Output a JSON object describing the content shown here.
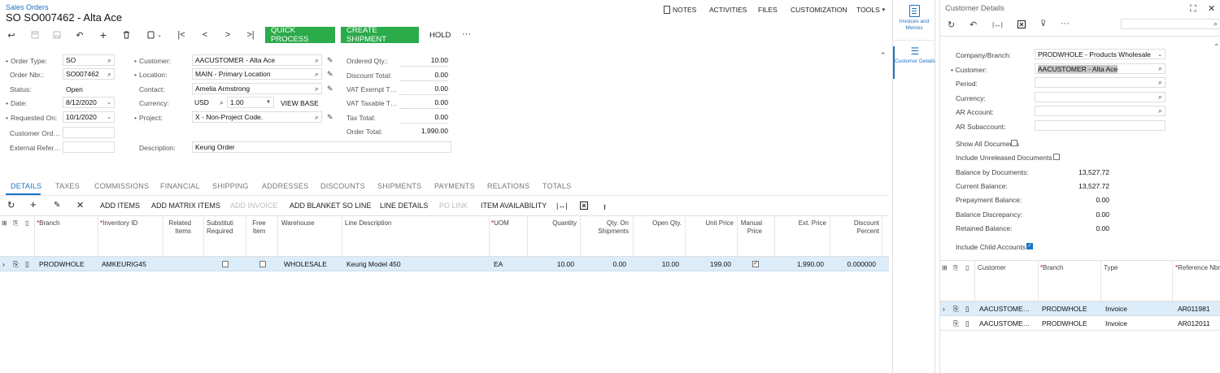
{
  "breadcrumb": "Sales Orders",
  "page_title": "SO SO007462 - Alta Ace",
  "top_menu": {
    "notes": "NOTES",
    "activities": "ACTIVITIES",
    "files": "FILES",
    "customization": "CUSTOMIZATION",
    "tools": "TOOLS"
  },
  "toolbar": {
    "quick_process": "QUICK PROCESS",
    "create_shipment": "CREATE SHIPMENT",
    "hold": "HOLD",
    "more": "···"
  },
  "form": {
    "order_type_label": "Order Type:",
    "order_type": "SO",
    "order_nbr_label": "Order Nbr.:",
    "order_nbr": "SO007462",
    "status_label": "Status:",
    "status": "Open",
    "date_label": "Date:",
    "date": "8/12/2020",
    "requested_on_label": "Requested On:",
    "requested_on": "10/1/2020",
    "customer_ord_label": "Customer Ord…",
    "customer_ord": "",
    "external_ref_label": "External Refer…",
    "external_ref": "",
    "customer_label": "Customer:",
    "customer": "AACUSTOMER - Alta Ace",
    "location_label": "Location:",
    "location": "MAIN - Primary Location",
    "contact_label": "Contact:",
    "contact": "Amelia Armstrong",
    "currency_label": "Currency:",
    "currency": "USD",
    "currency_rate": "1.00",
    "view_base": "VIEW BASE",
    "project_label": "Project:",
    "project": "X - Non-Project Code.",
    "description_label": "Description:",
    "description": "Keurig Order",
    "ordered_qty_label": "Ordered Qty.:",
    "ordered_qty": "10.00",
    "discount_total_label": "Discount Total:",
    "discount_total": "0.00",
    "vat_exempt_label": "VAT Exempt T…",
    "vat_exempt": "0.00",
    "vat_taxable_label": "VAT Taxable T…",
    "vat_taxable": "0.00",
    "tax_total_label": "Tax Total:",
    "tax_total": "0.00",
    "order_total_label": "Order Total:",
    "order_total": "1,990.00"
  },
  "tabs": [
    "DETAILS",
    "TAXES",
    "COMMISSIONS",
    "FINANCIAL",
    "SHIPPING",
    "ADDRESSES",
    "DISCOUNTS",
    "SHIPMENTS",
    "PAYMENTS",
    "RELATIONS",
    "TOTALS"
  ],
  "grid_toolbar": {
    "add_items": "ADD ITEMS",
    "add_matrix_items": "ADD MATRIX ITEMS",
    "add_invoice": "ADD INVOICE",
    "add_blanket_so_line": "ADD BLANKET SO LINE",
    "line_details": "LINE DETAILS",
    "po_link": "PO LINK",
    "item_availability": "ITEM AVAILABILITY"
  },
  "grid": {
    "headers": {
      "branch": "Branch",
      "inventory_id": "Inventory ID",
      "related_items": "Related Items",
      "substitution_required": "Substituti Required",
      "free_item": "Free Item",
      "warehouse": "Warehouse",
      "line_description": "Line Description",
      "uom": "UOM",
      "quantity": "Quantity",
      "qty_on_shipments": "Qty. On Shipments",
      "open_qty": "Open Qty.",
      "unit_price": "Unit Price",
      "manual_price": "Manual Price",
      "ext_price": "Ext. Price",
      "discount_percent": "Discount Percent"
    },
    "row": {
      "branch": "PRODWHOLE",
      "inventory_id": "AMKEURIG45",
      "warehouse": "WHOLESALE",
      "line_description": "Keurig Model 450",
      "uom": "EA",
      "quantity": "10.00",
      "qty_on_shipments": "0.00",
      "open_qty": "10.00",
      "unit_price": "199.00",
      "manual_price": true,
      "ext_price": "1,990.00",
      "discount_percent": "0.000000"
    }
  },
  "sidebar": {
    "invoices_memos": "Invoices and Memos",
    "customer_details": "Customer Details"
  },
  "customer_details": {
    "title": "Customer Details",
    "company_branch_label": "Company/Branch:",
    "company_branch": "PRODWHOLE - Products Wholesale",
    "customer_label": "Customer:",
    "customer": "AACUSTOMER - Alta Ace",
    "period_label": "Period:",
    "currency_label": "Currency:",
    "ar_account_label": "AR Account:",
    "ar_subaccount_label": "AR Subaccount:",
    "show_all_documents": "Show All Documents",
    "include_unreleased": "Include Unreleased Documents",
    "balance_by_documents_label": "Balance by Documents:",
    "balance_by_documents": "13,527.72",
    "current_balance_label": "Current Balance:",
    "current_balance": "13,527.72",
    "prepayment_balance_label": "Prepayment Balance:",
    "prepayment_balance": "0.00",
    "balance_discrepancy_label": "Balance Discrepancy:",
    "balance_discrepancy": "0.00",
    "retained_balance_label": "Retained Balance:",
    "retained_balance": "0.00",
    "include_child_accounts": "Include Child Accounts",
    "grid_headers": {
      "customer": "Customer",
      "branch": "Branch",
      "type": "Type",
      "reference_nbr": "Reference Nbr"
    },
    "rows": [
      {
        "customer": "AACUSTOME…",
        "branch": "PRODWHOLE",
        "type": "Invoice",
        "reference_nbr": "AR011981"
      },
      {
        "customer": "AACUSTOME…",
        "branch": "PRODWHOLE",
        "type": "Invoice",
        "reference_nbr": "AR012011"
      }
    ]
  },
  "colors": {
    "accent": "#1a73c6",
    "green_button": "#2bab4a",
    "selected_row": "#dcecf8"
  }
}
